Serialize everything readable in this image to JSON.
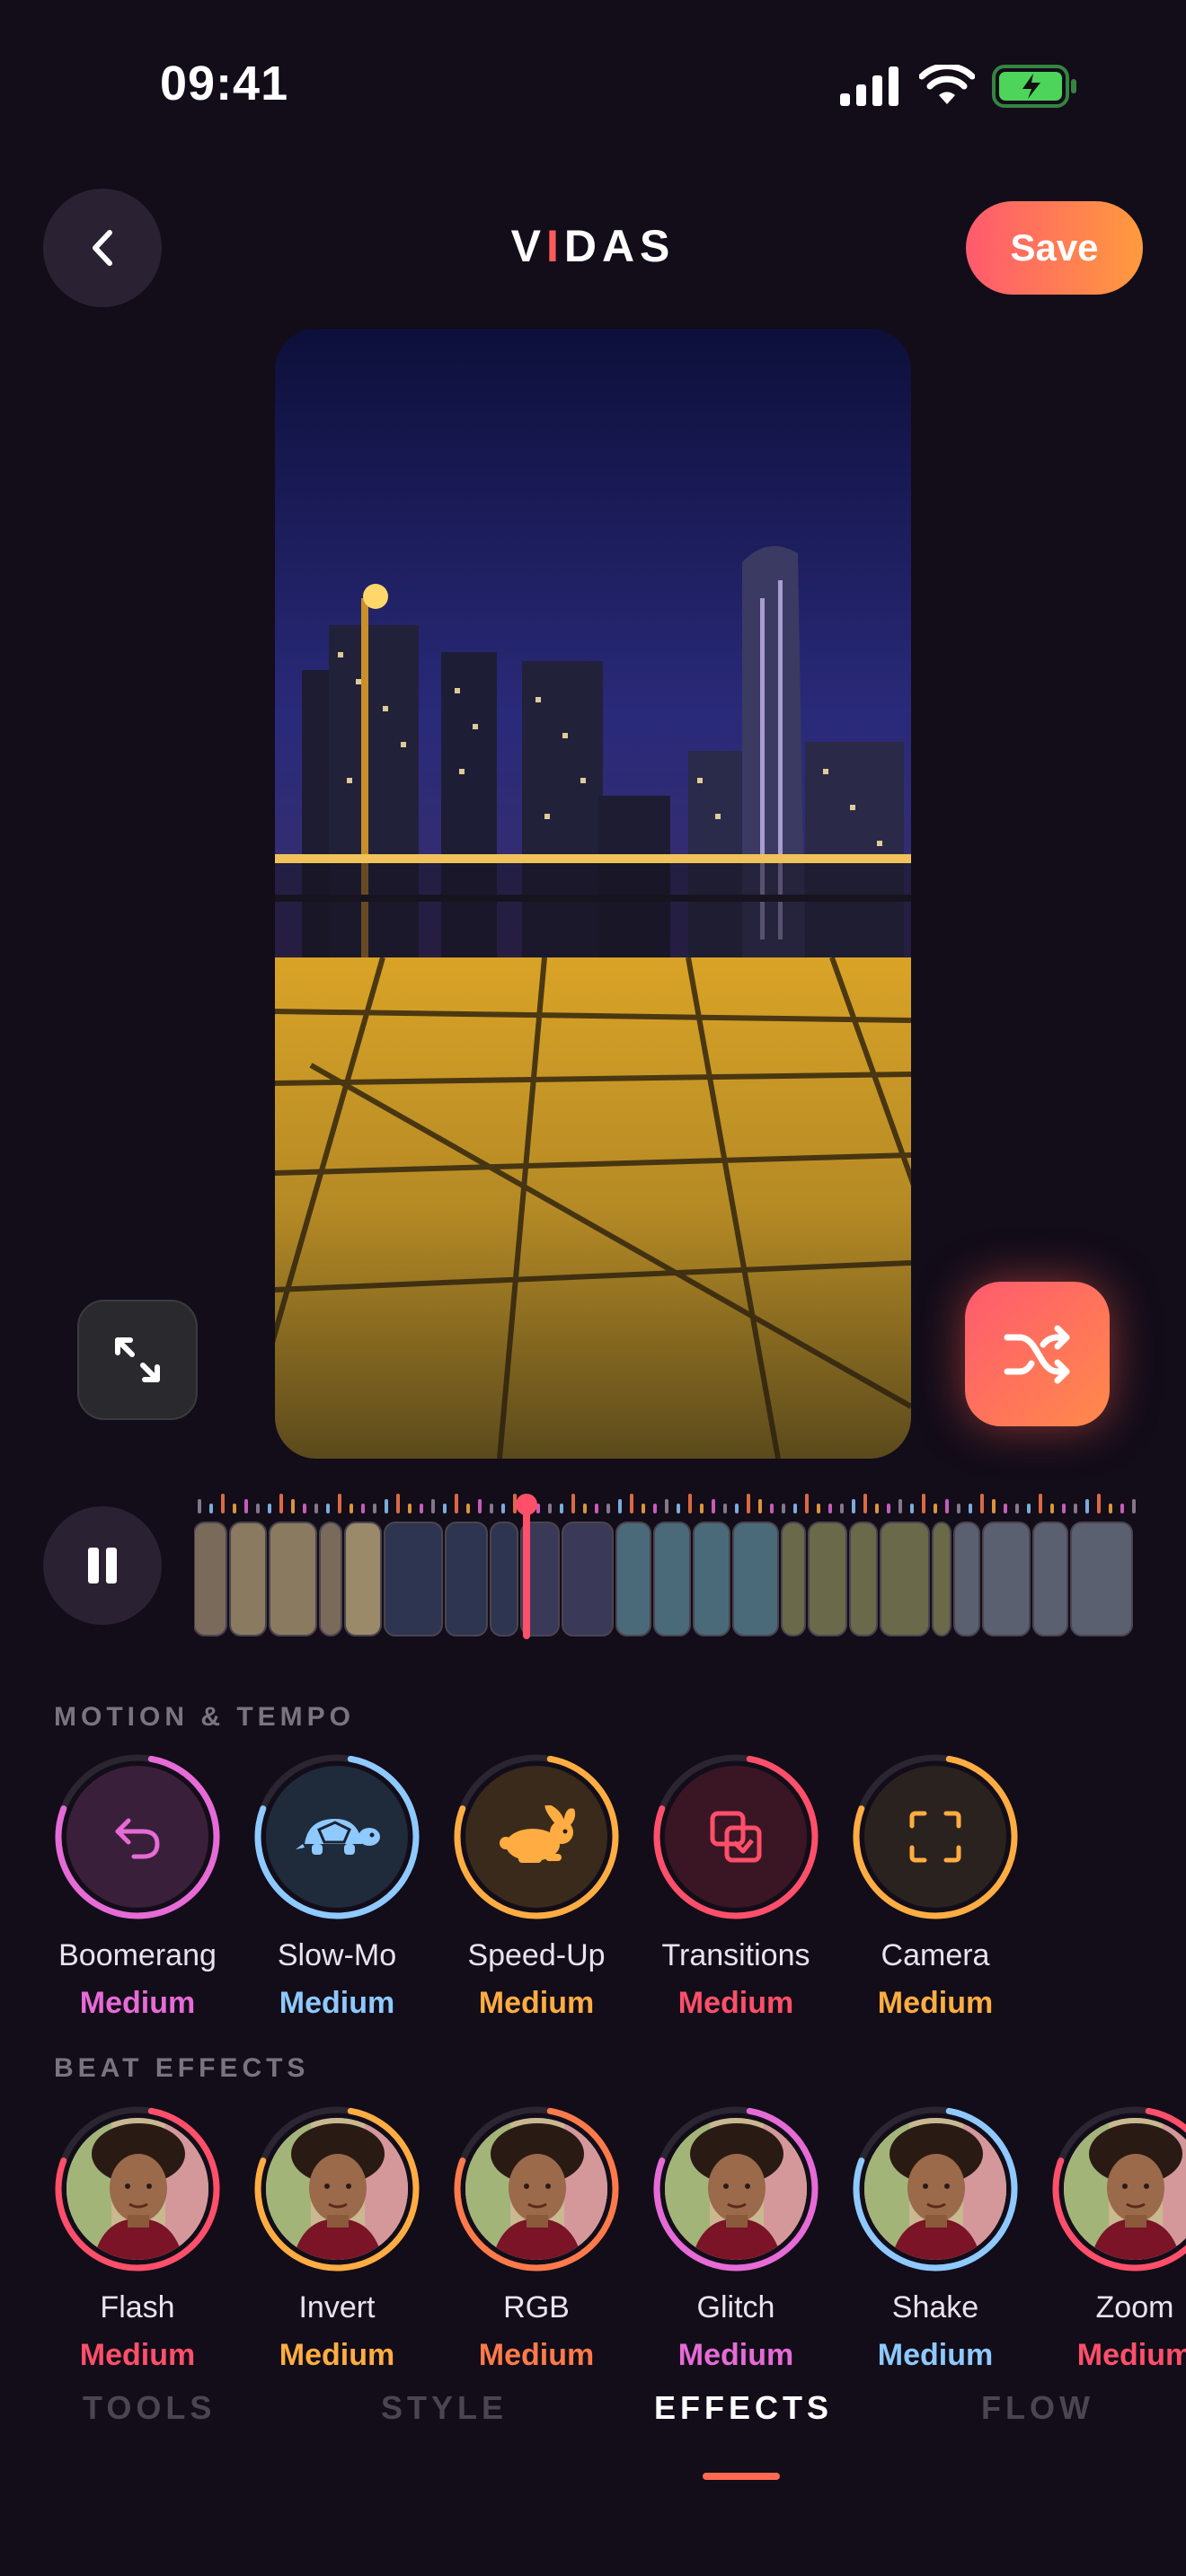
{
  "status": {
    "time": "09:41"
  },
  "header": {
    "logo": "VIDAS",
    "logo_prefix": "V",
    "logo_accent": "I",
    "logo_suffix": "DAS",
    "save_label": "Save"
  },
  "motion": {
    "title": "MOTION & TEMPO",
    "items": [
      {
        "name": "Boomerang",
        "level": "Medium",
        "color": "#e66bd6",
        "icon": "boomerang-icon"
      },
      {
        "name": "Slow-Mo",
        "level": "Medium",
        "color": "#8ec9ff",
        "icon": "turtle-icon"
      },
      {
        "name": "Speed-Up",
        "level": "Medium",
        "color": "#ffad42",
        "icon": "rabbit-icon"
      },
      {
        "name": "Transitions",
        "level": "Medium",
        "color": "#ff4f6a",
        "icon": "transitions-icon"
      },
      {
        "name": "Camera",
        "level": "Medium",
        "color": "#ffad42",
        "icon": "camera-frame-icon"
      }
    ]
  },
  "beat": {
    "title": "BEAT EFFECTS",
    "items": [
      {
        "name": "Flash",
        "level": "Medium",
        "color": "#ff4f6a"
      },
      {
        "name": "Invert",
        "level": "Medium",
        "color": "#ffad42"
      },
      {
        "name": "RGB",
        "level": "Medium",
        "color": "#ff7a4a"
      },
      {
        "name": "Glitch",
        "level": "Medium",
        "color": "#e66bd6"
      },
      {
        "name": "Shake",
        "level": "Medium",
        "color": "#8ec9ff"
      },
      {
        "name": "Zoom",
        "level": "Medium",
        "color": "#ff4f6a"
      }
    ]
  },
  "tabs": [
    {
      "label": "TOOLS"
    },
    {
      "label": "STYLE"
    },
    {
      "label": "EFFECTS",
      "active": true
    },
    {
      "label": "FLOW"
    }
  ],
  "colors": {
    "accent_start": "#ff5a6e",
    "accent_end": "#ff9a3d",
    "background": "#120d19"
  }
}
